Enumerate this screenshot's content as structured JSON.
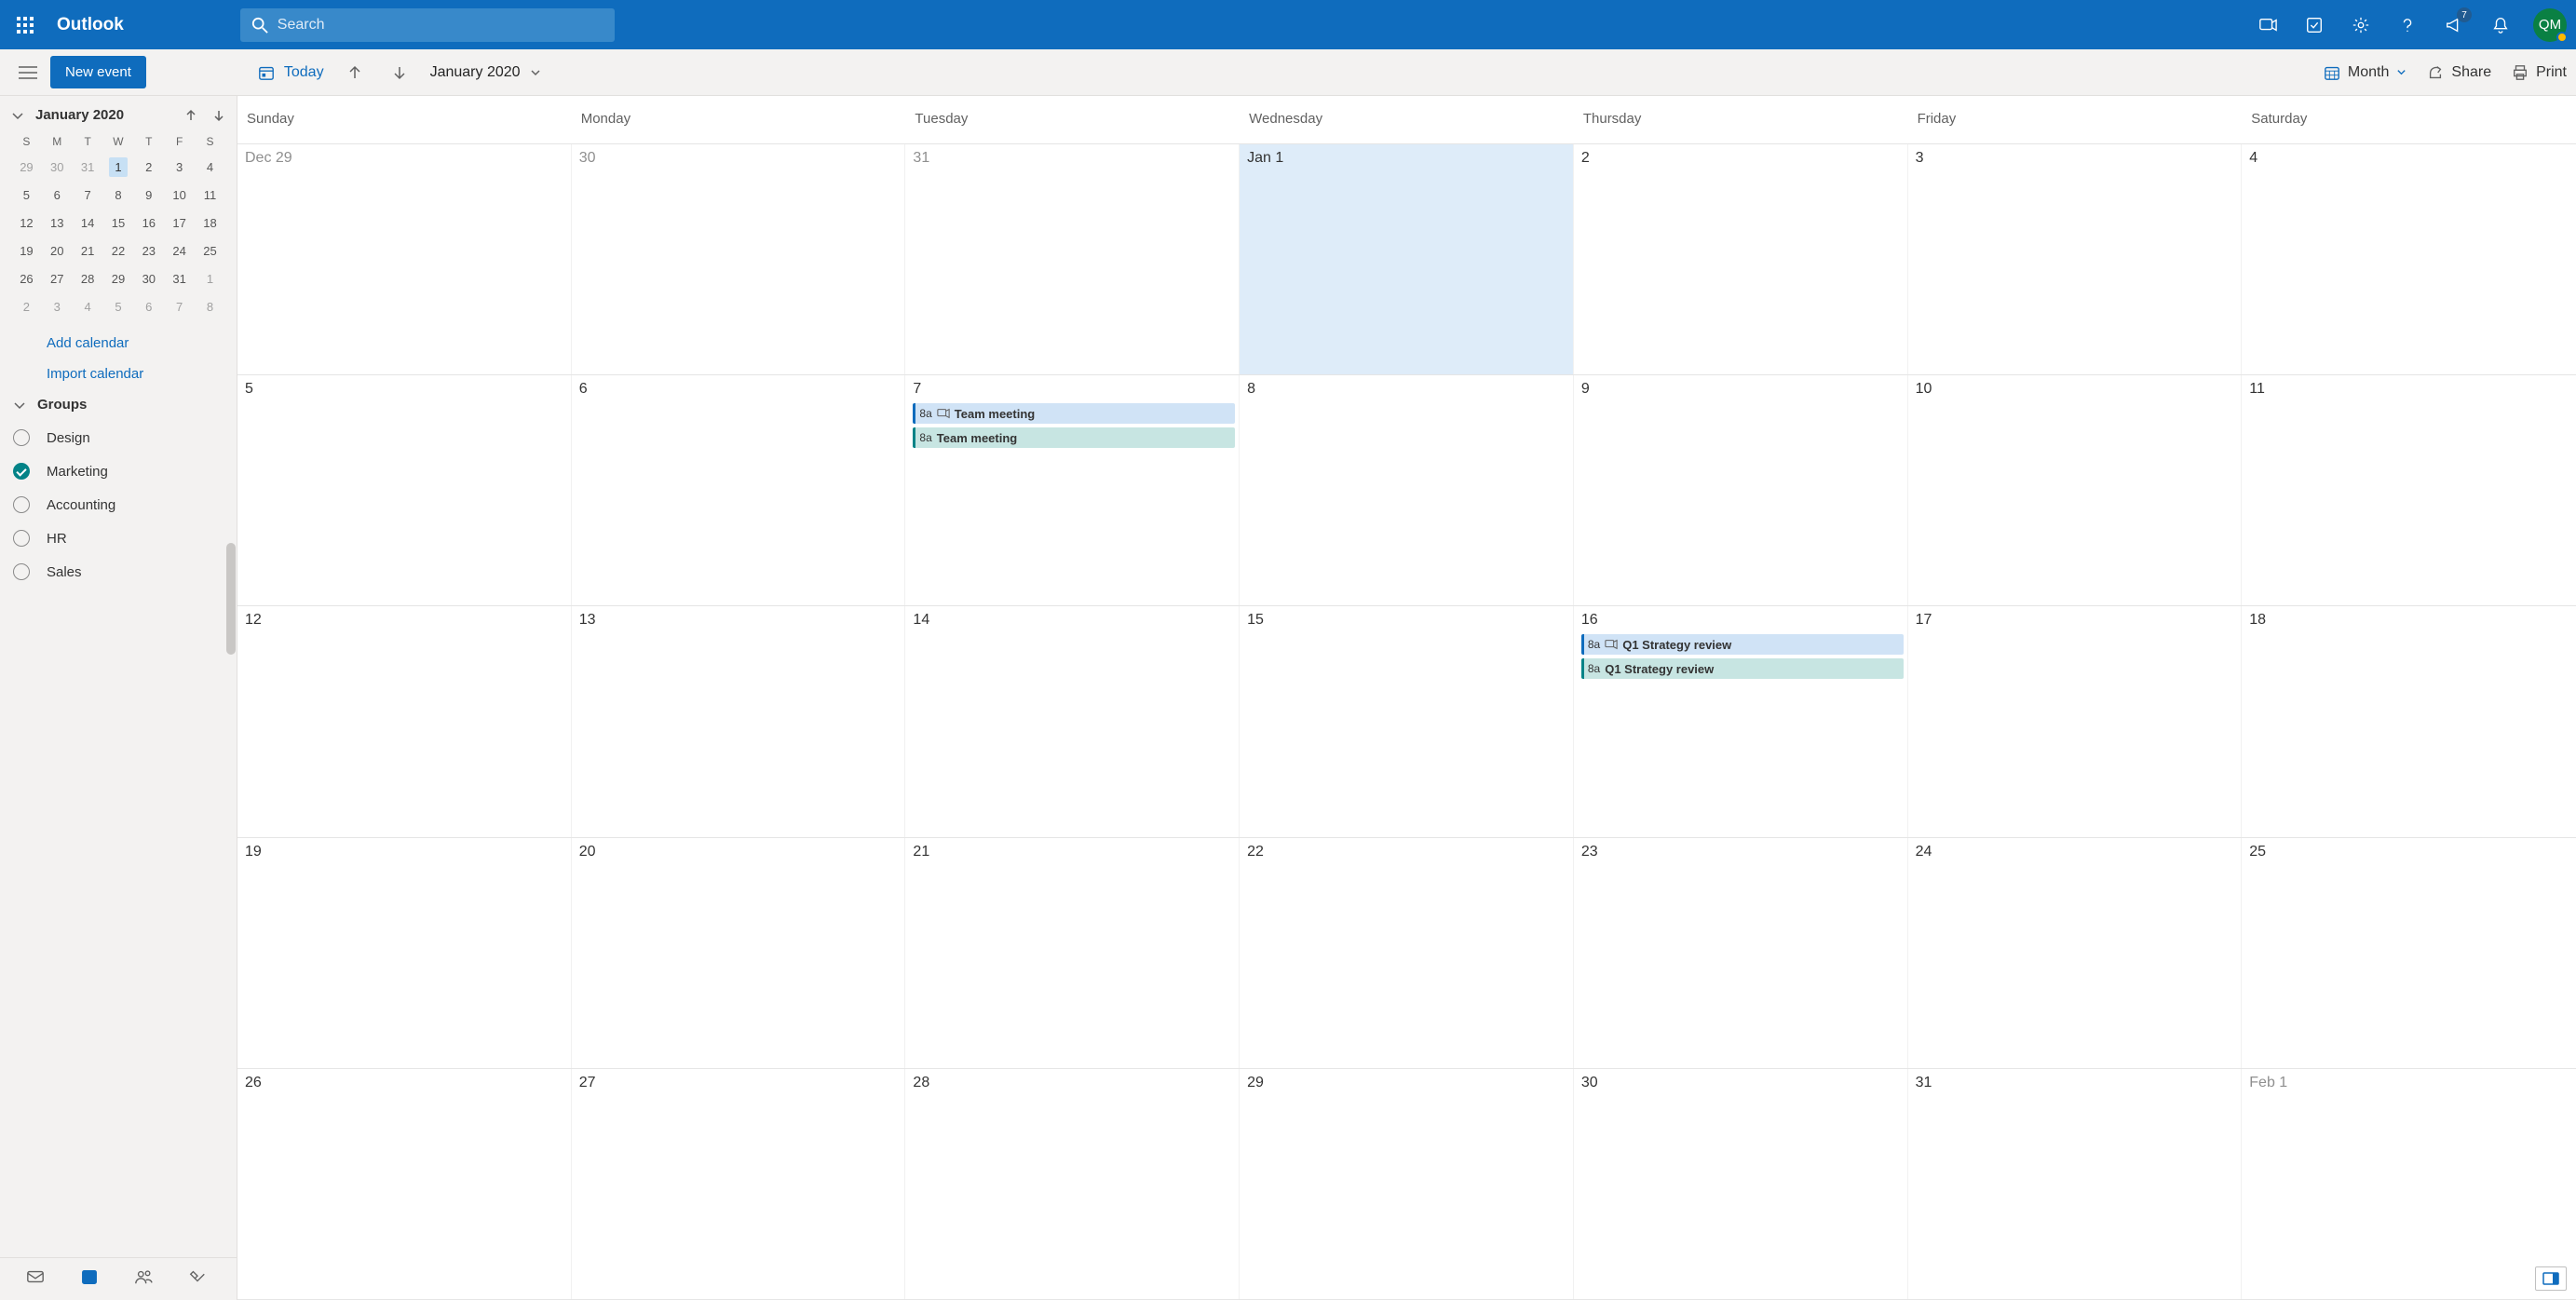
{
  "header": {
    "brand": "Outlook",
    "search_placeholder": "Search",
    "announcement_badge": "7",
    "avatar_initials": "QM"
  },
  "toolbar": {
    "new_event": "New event",
    "today": "Today",
    "month_label": "January 2020",
    "view": "Month",
    "share": "Share",
    "print": "Print"
  },
  "sidebar": {
    "dp_title": "January 2020",
    "dow": [
      "S",
      "M",
      "T",
      "W",
      "T",
      "F",
      "S"
    ],
    "rows": [
      [
        {
          "n": "29",
          "dim": true
        },
        {
          "n": "30",
          "dim": true
        },
        {
          "n": "31",
          "dim": true
        },
        {
          "n": "1",
          "sel": true
        },
        {
          "n": "2"
        },
        {
          "n": "3"
        },
        {
          "n": "4"
        }
      ],
      [
        {
          "n": "5"
        },
        {
          "n": "6"
        },
        {
          "n": "7"
        },
        {
          "n": "8"
        },
        {
          "n": "9"
        },
        {
          "n": "10"
        },
        {
          "n": "11"
        }
      ],
      [
        {
          "n": "12"
        },
        {
          "n": "13"
        },
        {
          "n": "14"
        },
        {
          "n": "15"
        },
        {
          "n": "16"
        },
        {
          "n": "17"
        },
        {
          "n": "18"
        }
      ],
      [
        {
          "n": "19"
        },
        {
          "n": "20"
        },
        {
          "n": "21"
        },
        {
          "n": "22"
        },
        {
          "n": "23"
        },
        {
          "n": "24"
        },
        {
          "n": "25"
        }
      ],
      [
        {
          "n": "26"
        },
        {
          "n": "27"
        },
        {
          "n": "28"
        },
        {
          "n": "29"
        },
        {
          "n": "30"
        },
        {
          "n": "31"
        },
        {
          "n": "1",
          "dim": true
        }
      ],
      [
        {
          "n": "2",
          "dim": true
        },
        {
          "n": "3",
          "dim": true
        },
        {
          "n": "4",
          "dim": true
        },
        {
          "n": "5",
          "dim": true
        },
        {
          "n": "6",
          "dim": true
        },
        {
          "n": "7",
          "dim": true
        },
        {
          "n": "8",
          "dim": true
        }
      ]
    ],
    "add_calendar": "Add calendar",
    "import_calendar": "Import calendar",
    "groups_label": "Groups",
    "groups": [
      {
        "name": "Design",
        "checked": false
      },
      {
        "name": "Marketing",
        "checked": true
      },
      {
        "name": "Accounting",
        "checked": false
      },
      {
        "name": "HR",
        "checked": false
      },
      {
        "name": "Sales",
        "checked": false
      }
    ]
  },
  "calendar": {
    "dow": [
      "Sunday",
      "Monday",
      "Tuesday",
      "Wednesday",
      "Thursday",
      "Friday",
      "Saturday"
    ],
    "weeks": [
      [
        {
          "label": "Dec 29",
          "dim": true
        },
        {
          "label": "30",
          "dim": true
        },
        {
          "label": "31",
          "dim": true
        },
        {
          "label": "Jan 1",
          "today": true
        },
        {
          "label": "2"
        },
        {
          "label": "3"
        },
        {
          "label": "4"
        }
      ],
      [
        {
          "label": "5"
        },
        {
          "label": "6"
        },
        {
          "label": "7",
          "events": [
            {
              "time": "8a",
              "title": "Team meeting",
              "cls": "blue",
              "icon": true
            },
            {
              "time": "8a",
              "title": "Team meeting",
              "cls": "teal"
            }
          ]
        },
        {
          "label": "8"
        },
        {
          "label": "9"
        },
        {
          "label": "10"
        },
        {
          "label": "11"
        }
      ],
      [
        {
          "label": "12"
        },
        {
          "label": "13"
        },
        {
          "label": "14"
        },
        {
          "label": "15"
        },
        {
          "label": "16",
          "events": [
            {
              "time": "8a",
              "title": "Q1 Strategy review",
              "cls": "blue",
              "icon": true
            },
            {
              "time": "8a",
              "title": "Q1 Strategy review",
              "cls": "teal"
            }
          ]
        },
        {
          "label": "17"
        },
        {
          "label": "18"
        }
      ],
      [
        {
          "label": "19"
        },
        {
          "label": "20"
        },
        {
          "label": "21"
        },
        {
          "label": "22"
        },
        {
          "label": "23"
        },
        {
          "label": "24"
        },
        {
          "label": "25"
        }
      ],
      [
        {
          "label": "26"
        },
        {
          "label": "27"
        },
        {
          "label": "28"
        },
        {
          "label": "29"
        },
        {
          "label": "30"
        },
        {
          "label": "31"
        },
        {
          "label": "Feb 1",
          "dim": true
        }
      ]
    ]
  }
}
